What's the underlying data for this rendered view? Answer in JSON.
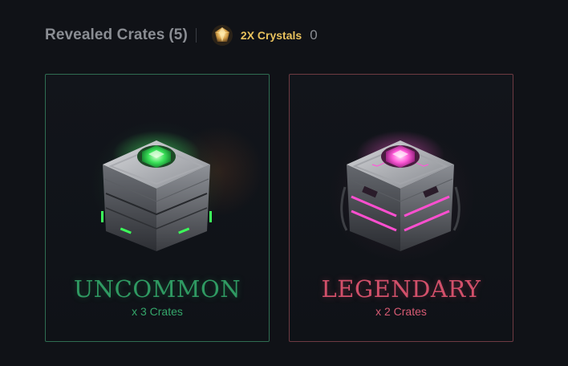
{
  "header": {
    "title": "Revealed Crates",
    "count": "(5)",
    "bonus_label": "2X Crystals",
    "bonus_value": "0"
  },
  "cards": [
    {
      "rarity": "UNCOMMON",
      "count_label": "x 3 Crates",
      "accent": "#2f9a62",
      "gem_color": "#3be35a"
    },
    {
      "rarity": "LEGENDARY",
      "count_label": "x 2 Crates",
      "accent": "#d2506a",
      "gem_color": "#ff5ad8"
    }
  ],
  "colors": {
    "background": "#101217",
    "title": "#8a8d93",
    "bonus": "#e9c25d"
  },
  "icons": [
    "crystal-icon",
    "crate-icon"
  ]
}
